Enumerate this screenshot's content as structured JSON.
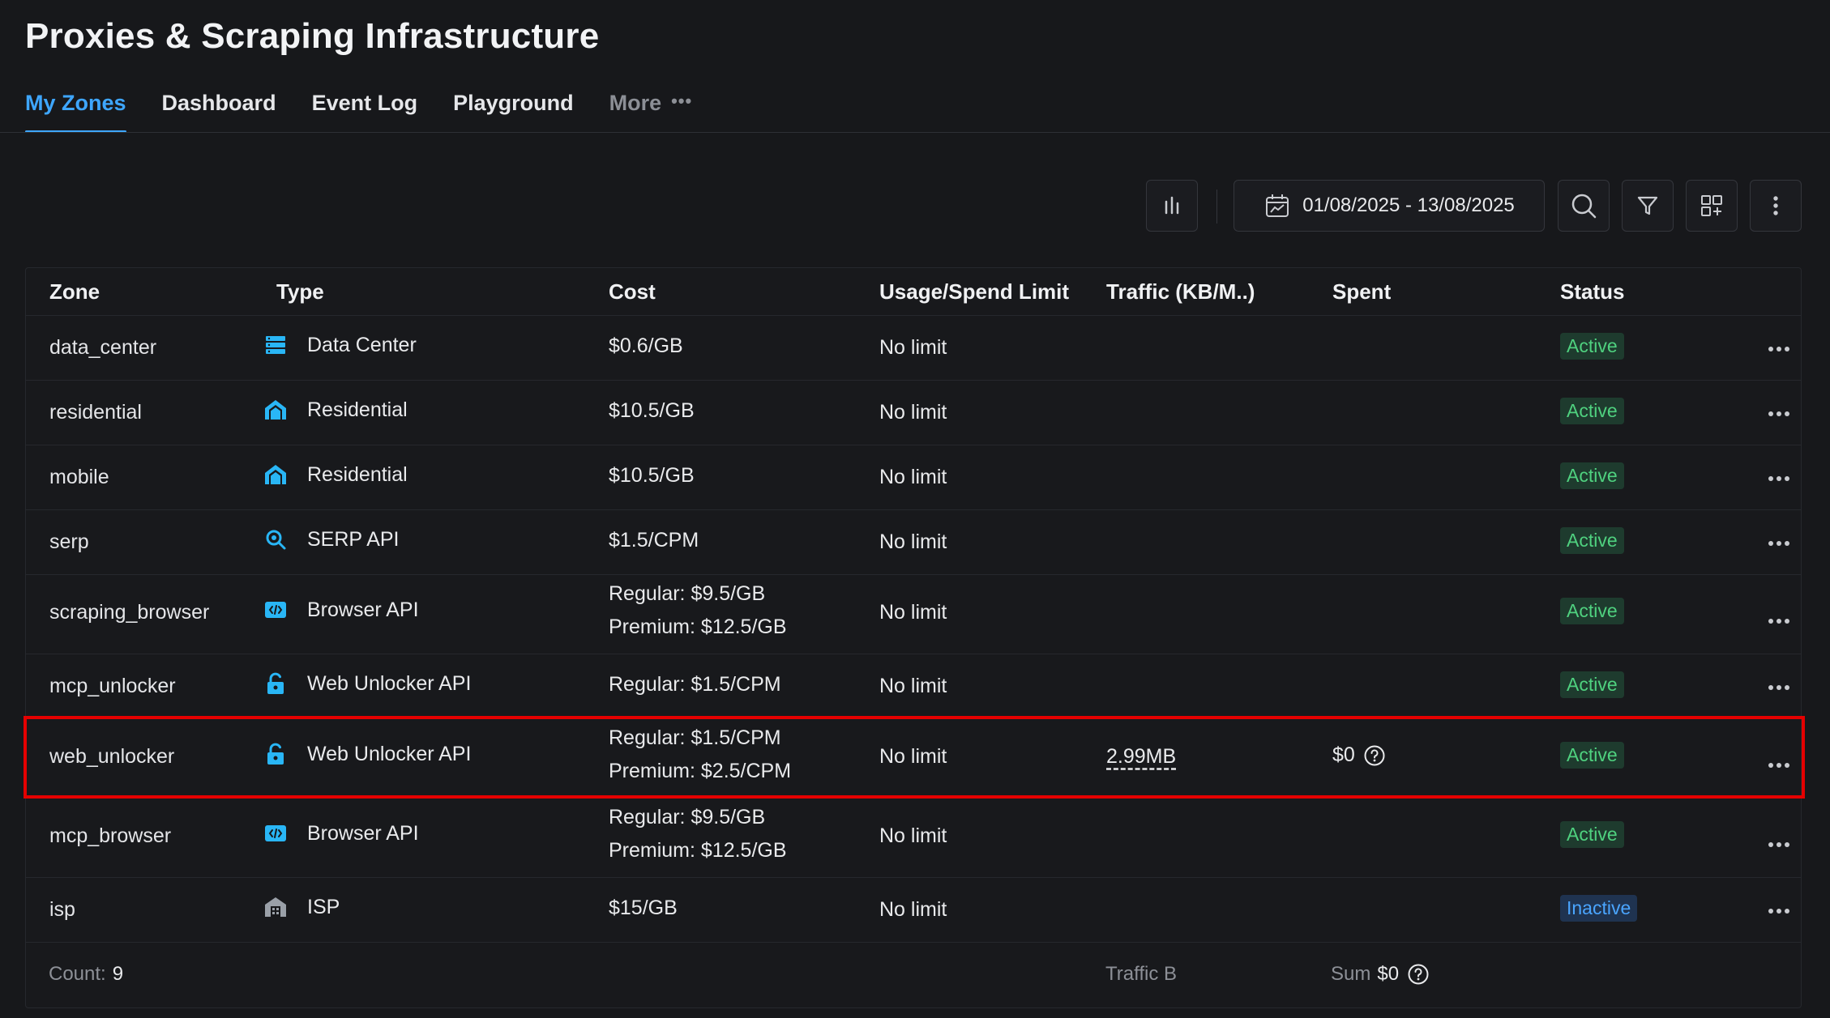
{
  "page": {
    "title": "Proxies & Scraping Infrastructure"
  },
  "tabs": [
    {
      "label": "My Zones",
      "active": true
    },
    {
      "label": "Dashboard"
    },
    {
      "label": "Event Log"
    },
    {
      "label": "Playground"
    },
    {
      "label": "More"
    }
  ],
  "toolbar": {
    "date_range": "01/08/2025 - 13/08/2025",
    "icons": [
      "bar-chart-icon",
      "calendar-icon",
      "search-icon",
      "filter-icon",
      "add-widget-icon",
      "kebab-menu-icon"
    ]
  },
  "table": {
    "columns": [
      "Zone",
      "Type",
      "Cost",
      "Usage/Spend Limit",
      "Traffic (KB/M..)",
      "Spent",
      "Status"
    ],
    "rows": [
      {
        "zone": "data_center",
        "type": "Data Center",
        "type_icon": "server-icon",
        "cost": [
          "$0.6/GB"
        ],
        "limit": "No limit",
        "traffic": "",
        "spent": "",
        "status": "Active"
      },
      {
        "zone": "residential",
        "type": "Residential",
        "type_icon": "house-icon",
        "cost": [
          "$10.5/GB"
        ],
        "limit": "No limit",
        "traffic": "",
        "spent": "",
        "status": "Active"
      },
      {
        "zone": "mobile",
        "type": "Residential",
        "type_icon": "house-icon",
        "cost": [
          "$10.5/GB"
        ],
        "limit": "No limit",
        "traffic": "",
        "spent": "",
        "status": "Active"
      },
      {
        "zone": "serp",
        "type": "SERP API",
        "type_icon": "search-gear-icon",
        "cost": [
          "$1.5/CPM"
        ],
        "limit": "No limit",
        "traffic": "",
        "spent": "",
        "status": "Active"
      },
      {
        "zone": "scraping_browser",
        "type": "Browser API",
        "type_icon": "code-window-icon",
        "cost": [
          "Regular: $9.5/GB",
          "Premium: $12.5/GB"
        ],
        "limit": "No limit",
        "traffic": "",
        "spent": "",
        "status": "Active"
      },
      {
        "zone": "mcp_unlocker",
        "type": "Web Unlocker API",
        "type_icon": "unlock-icon",
        "cost": [
          "Regular: $1.5/CPM"
        ],
        "limit": "No limit",
        "traffic": "",
        "spent": "",
        "status": "Active"
      },
      {
        "zone": "web_unlocker",
        "type": "Web Unlocker API",
        "type_icon": "unlock-icon",
        "cost": [
          "Regular: $1.5/CPM",
          "Premium: $2.5/CPM"
        ],
        "limit": "No limit",
        "traffic": "2.99MB",
        "spent": "$0",
        "status": "Active",
        "highlighted": true
      },
      {
        "zone": "mcp_browser",
        "type": "Browser API",
        "type_icon": "code-window-icon",
        "cost": [
          "Regular: $9.5/GB",
          "Premium: $12.5/GB"
        ],
        "limit": "No limit",
        "traffic": "",
        "spent": "",
        "status": "Active"
      },
      {
        "zone": "isp",
        "type": "ISP",
        "type_icon": "building-icon",
        "cost": [
          "$15/GB"
        ],
        "limit": "No limit",
        "traffic": "",
        "spent": "",
        "status": "Inactive"
      }
    ],
    "footer": {
      "count_label": "Count:",
      "count_value": "9",
      "traffic_label": "Traffic B",
      "sum_label": "Sum",
      "sum_value": "$0"
    }
  },
  "colors": {
    "accent": "#3ea6ff",
    "active_text": "#4fd17f",
    "active_bg": "#1e3b2e",
    "inactive_text": "#4aa5ff",
    "inactive_bg": "#1f3350",
    "highlight": "#e50000"
  }
}
